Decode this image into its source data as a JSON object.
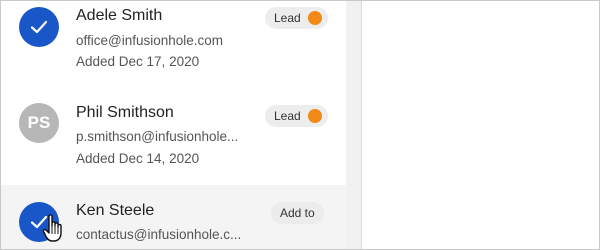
{
  "contacts": [
    {
      "name": "Adele Smith",
      "email": "office@infusionhole.com",
      "added": "Added Dec 17, 2020",
      "tag": "Lead",
      "selected": true,
      "tag_dot_color": "#f28a1a"
    },
    {
      "initials": "PS",
      "name": "Phil Smithson",
      "email": "p.smithson@infusionhole...",
      "added": "Added Dec 14, 2020",
      "tag": "Lead",
      "selected": false,
      "tag_dot_color": "#f28a1a"
    },
    {
      "name": "Ken Steele",
      "email": "contactus@infusionhole.c...",
      "action": "Add to",
      "selected": true,
      "hovered": true
    }
  ],
  "colors": {
    "selected_avatar": "#1957c8",
    "initials_avatar": "#b7b7b7",
    "hover_row": "#f4f4f4",
    "divider": "#f1f1f1"
  },
  "icons": {
    "check": "check-icon",
    "cursor": "hand-pointer-icon"
  }
}
